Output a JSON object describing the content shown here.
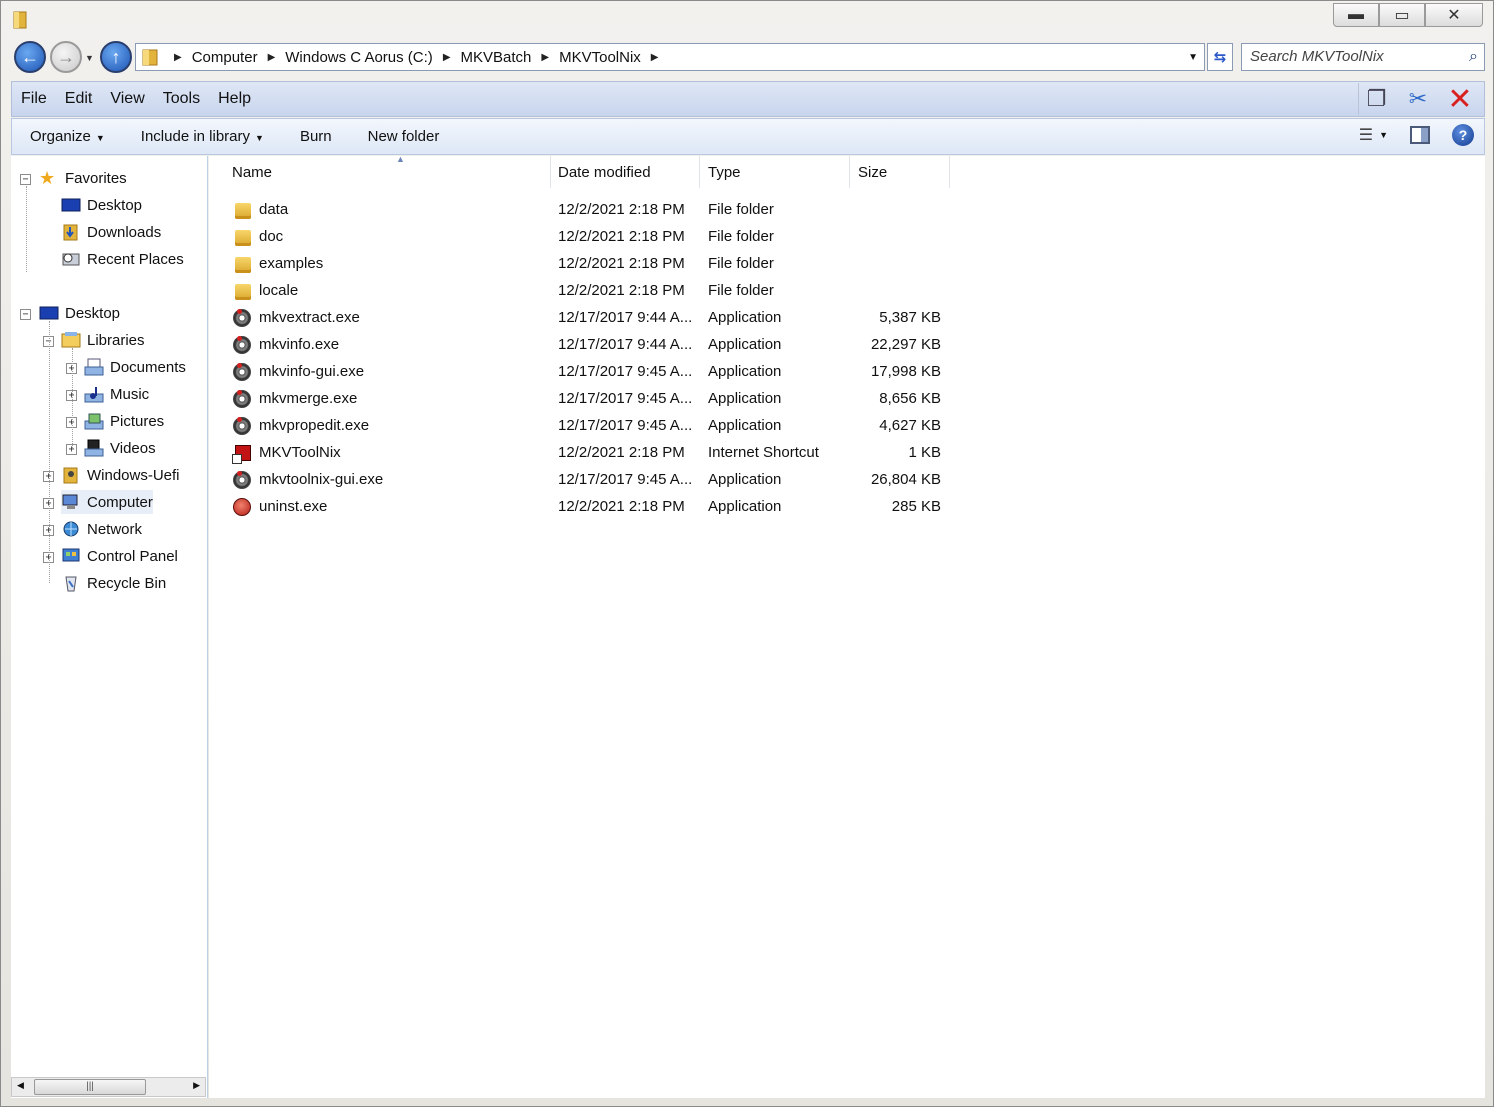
{
  "window": {
    "minimize_glyph": "▬",
    "maximize_glyph": "▭",
    "close_glyph": "✕"
  },
  "address": {
    "crumbs": [
      "Computer",
      "Windows C Aorus (C:)",
      "MKVBatch",
      "MKVToolNix"
    ],
    "search_placeholder": "Search MKVToolNix"
  },
  "menu": [
    "File",
    "Edit",
    "View",
    "Tools",
    "Help"
  ],
  "commands": {
    "organize": "Organize",
    "include": "Include in library",
    "burn": "Burn",
    "new_folder": "New folder"
  },
  "nav": {
    "favorites": "Favorites",
    "fav_desktop": "Desktop",
    "downloads": "Downloads",
    "recent": "Recent Places",
    "desktop": "Desktop",
    "libraries": "Libraries",
    "documents": "Documents",
    "music": "Music",
    "pictures": "Pictures",
    "videos": "Videos",
    "windows_uefi": "Windows-Uefi",
    "computer": "Computer",
    "network": "Network",
    "control_panel": "Control Panel",
    "recycle_bin": "Recycle Bin"
  },
  "columns": {
    "name": "Name",
    "date": "Date modified",
    "type": "Type",
    "size": "Size"
  },
  "files": [
    {
      "name": "data",
      "date": "12/2/2021 2:18 PM",
      "type": "File folder",
      "size": "",
      "icon": "folder-icon"
    },
    {
      "name": "doc",
      "date": "12/2/2021 2:18 PM",
      "type": "File folder",
      "size": "",
      "icon": "folder-icon"
    },
    {
      "name": "examples",
      "date": "12/2/2021 2:18 PM",
      "type": "File folder",
      "size": "",
      "icon": "folder-icon"
    },
    {
      "name": "locale",
      "date": "12/2/2021 2:18 PM",
      "type": "File folder",
      "size": "",
      "icon": "folder-icon"
    },
    {
      "name": "mkvextract.exe",
      "date": "12/17/2017 9:44 A...",
      "type": "Application",
      "size": "5,387 KB",
      "icon": "mkvtoolnix-app-icon"
    },
    {
      "name": "mkvinfo.exe",
      "date": "12/17/2017 9:44 A...",
      "type": "Application",
      "size": "22,297 KB",
      "icon": "mkvtoolnix-app-icon"
    },
    {
      "name": "mkvinfo-gui.exe",
      "date": "12/17/2017 9:45 A...",
      "type": "Application",
      "size": "17,998 KB",
      "icon": "mkvtoolnix-app-icon"
    },
    {
      "name": "mkvmerge.exe",
      "date": "12/17/2017 9:45 A...",
      "type": "Application",
      "size": "8,656 KB",
      "icon": "mkvtoolnix-app-icon"
    },
    {
      "name": "mkvpropedit.exe",
      "date": "12/17/2017 9:45 A...",
      "type": "Application",
      "size": "4,627 KB",
      "icon": "mkvtoolnix-app-icon"
    },
    {
      "name": "MKVToolNix",
      "date": "12/2/2021 2:18 PM",
      "type": "Internet Shortcut",
      "size": "1 KB",
      "icon": "internet-shortcut-icon"
    },
    {
      "name": "mkvtoolnix-gui.exe",
      "date": "12/17/2017 9:45 A...",
      "type": "Application",
      "size": "26,804 KB",
      "icon": "mkvtoolnix-app-icon"
    },
    {
      "name": "uninst.exe",
      "date": "12/2/2021 2:18 PM",
      "type": "Application",
      "size": "285 KB",
      "icon": "uninstaller-icon"
    }
  ]
}
